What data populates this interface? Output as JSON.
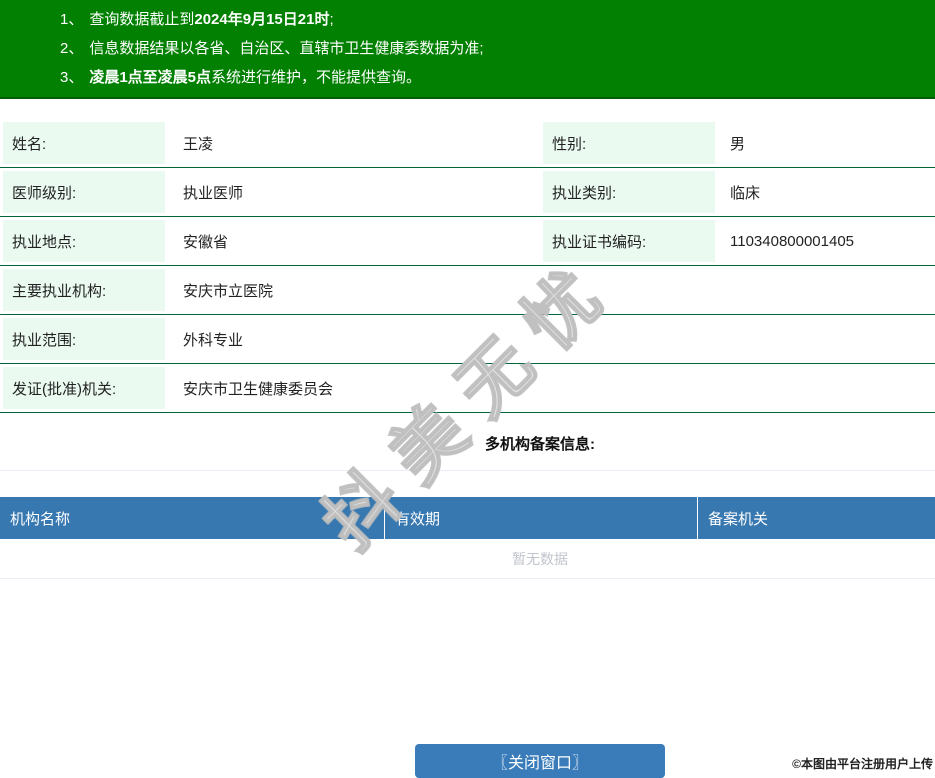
{
  "notice": {
    "items": [
      {
        "num": "1、",
        "pre": "查询数据截止到",
        "bold": "2024年9月15日21时",
        "post": ";"
      },
      {
        "num": "2、",
        "pre": "信息数据结果以各省、自治区、直辖市卫生健康委数据为准;",
        "bold": "",
        "post": ""
      },
      {
        "num": "3、",
        "pre": "",
        "bold": "凌晨1点至凌晨5点",
        "post": "系统进行维护，不能提供查询。"
      }
    ]
  },
  "profile": {
    "rows": [
      {
        "cells": [
          {
            "label": "姓名:",
            "value": "王凌"
          },
          {
            "label": "性别:",
            "value": "男"
          }
        ]
      },
      {
        "cells": [
          {
            "label": "医师级别:",
            "value": "执业医师"
          },
          {
            "label": "执业类别:",
            "value": "临床"
          }
        ]
      },
      {
        "cells": [
          {
            "label": "执业地点:",
            "value": "安徽省"
          },
          {
            "label": "执业证书编码:",
            "value": "110340800001405"
          }
        ]
      },
      {
        "cells": [
          {
            "label": "主要执业机构:",
            "value": "安庆市立医院"
          }
        ]
      },
      {
        "cells": [
          {
            "label": "执业范围:",
            "value": "外科专业"
          }
        ]
      },
      {
        "cells": [
          {
            "label": "发证(批准)机关:",
            "value": "安庆市卫生健康委员会"
          }
        ]
      }
    ]
  },
  "filing": {
    "title": "多机构备案信息:",
    "columns": [
      "机构名称",
      "有效期",
      "备案机关"
    ],
    "empty_text": "暂无数据"
  },
  "close_button_label": "〖关闭窗口〗",
  "watermark_text": "抖美无忧",
  "footer_stamp": "©本图由平台注册用户上传",
  "colors": {
    "notice_background": "#018001",
    "notice_border": "#015d01",
    "row_border_green": "#00663a",
    "label_cell_mint": "#eafaf1",
    "table_header_blue": "#3778b0",
    "close_button_blue": "#3a7cba",
    "divider_gray": "#ebeef5",
    "empty_text_gray": "#c0c4cc"
  }
}
